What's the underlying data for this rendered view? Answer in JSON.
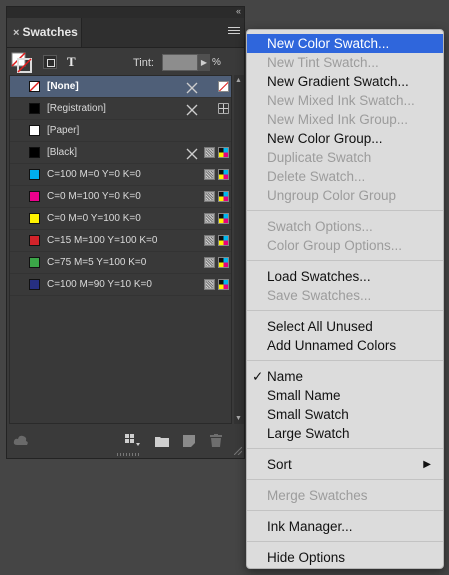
{
  "panel": {
    "tab_label": "Swatches",
    "tab_close": "×",
    "collapse_glyph": "‹‹",
    "tint_label": "Tint:",
    "tint_value": "",
    "tint_unit": "%",
    "text_tool_glyph": "T"
  },
  "swatches": [
    {
      "name": "[None]",
      "color": "none",
      "selected": true
    },
    {
      "name": "[Registration]",
      "color": "#000000"
    },
    {
      "name": "[Paper]",
      "color": "#ffffff"
    },
    {
      "name": "[Black]",
      "color": "#000000"
    },
    {
      "name": "C=100 M=0 Y=0 K=0",
      "color": "#00aeef"
    },
    {
      "name": "C=0 M=100 Y=0 K=0",
      "color": "#ec008c"
    },
    {
      "name": "C=0 M=0 Y=100 K=0",
      "color": "#fff200"
    },
    {
      "name": "C=15 M=100 Y=100 K=0",
      "color": "#d2232a"
    },
    {
      "name": "C=75 M=5 Y=100 K=0",
      "color": "#3ba648"
    },
    {
      "name": "C=100 M=90 Y=10 K=0",
      "color": "#262f80"
    }
  ],
  "menu": {
    "new_color_swatch": "New Color Swatch...",
    "new_tint_swatch": "New Tint Swatch...",
    "new_gradient_swatch": "New Gradient Swatch...",
    "new_mixed_ink_swatch": "New Mixed Ink Swatch...",
    "new_mixed_ink_group": "New Mixed Ink Group...",
    "new_color_group": "New Color Group...",
    "duplicate_swatch": "Duplicate Swatch",
    "delete_swatch": "Delete Swatch...",
    "ungroup_color_group": "Ungroup Color Group",
    "swatch_options": "Swatch Options...",
    "color_group_options": "Color Group Options...",
    "load_swatches": "Load Swatches...",
    "save_swatches": "Save Swatches...",
    "select_all_unused": "Select All Unused",
    "add_unnamed_colors": "Add Unnamed Colors",
    "name": "Name",
    "small_name": "Small Name",
    "small_swatch": "Small Swatch",
    "large_swatch": "Large Swatch",
    "sort": "Sort",
    "merge_swatches": "Merge Swatches",
    "ink_manager": "Ink Manager...",
    "hide_options": "Hide Options",
    "checkmark": "✓",
    "submenu_arrow": "▶"
  },
  "colors": {
    "panel_bg": "#3a3a3a",
    "selection": "#4f5f78",
    "menu_bg": "#dcdcdc",
    "menu_highlight": "#2f66dc"
  }
}
